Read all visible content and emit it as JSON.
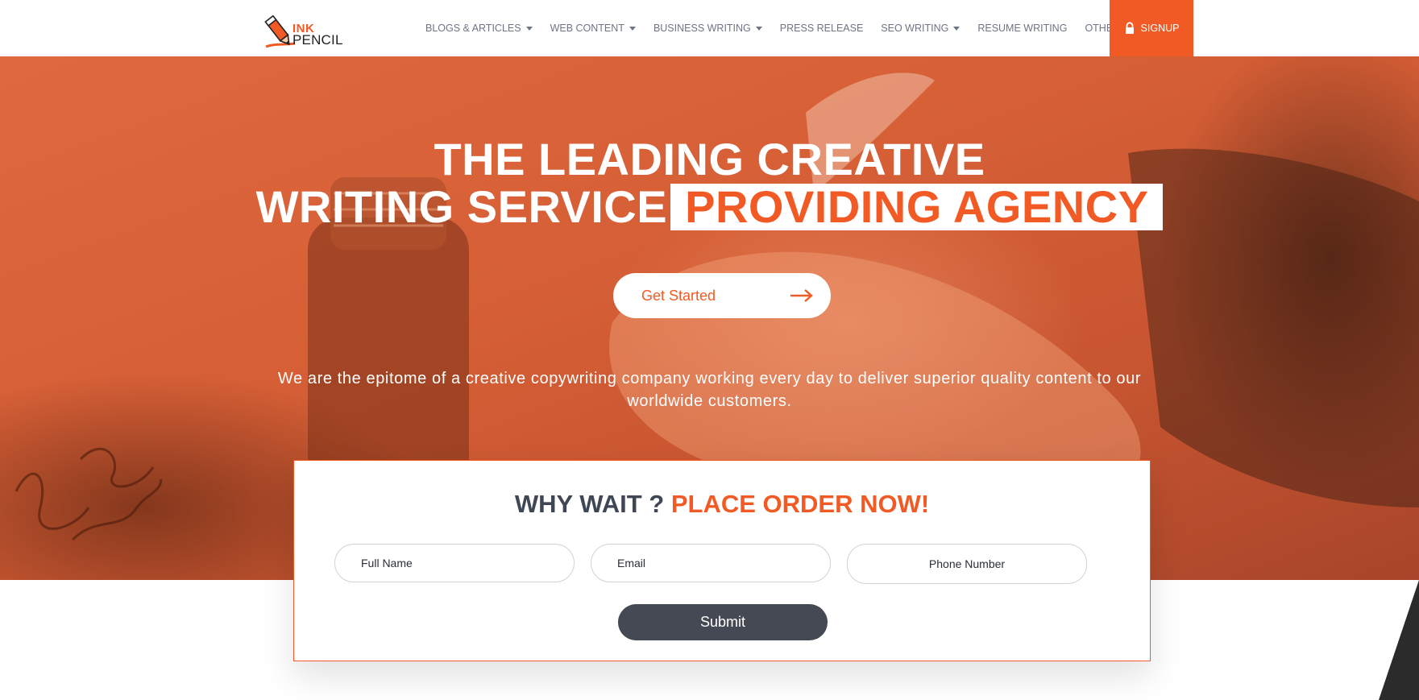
{
  "brand": {
    "logo_top": "INK",
    "logo_bottom": "PENCIL",
    "accent_color": "#f15a24"
  },
  "nav": {
    "items": [
      {
        "label": "BLOGS & ARTICLES",
        "dropdown": true
      },
      {
        "label": "WEB CONTENT",
        "dropdown": true
      },
      {
        "label": "BUSINESS WRITING",
        "dropdown": true
      },
      {
        "label": "PRESS RELEASE",
        "dropdown": false
      },
      {
        "label": "SEO WRITING",
        "dropdown": true
      },
      {
        "label": "RESUME WRITING",
        "dropdown": false
      },
      {
        "label": "OTHERS",
        "dropdown": true
      }
    ],
    "signup_label": "SIGNUP",
    "signup_icon": "lock-icon"
  },
  "hero": {
    "title_line1": "THE LEADING CREATIVE",
    "title_line2_plain": "WRITING SERVICE",
    "title_line2_highlight": "PROVIDING AGENCY",
    "cta_label": "Get Started",
    "cta_icon": "arrow-right-icon",
    "subtitle": "We are the epitome of a creative copywriting company working every day to deliver superior quality content to our worldwide customers."
  },
  "order_form": {
    "title_plain": "WHY WAIT ? ",
    "title_accent": "PLACE ORDER NOW!",
    "fields": {
      "full_name": "Full Name",
      "email": "Email",
      "phone": "Phone Number"
    },
    "submit_label": "Submit"
  }
}
